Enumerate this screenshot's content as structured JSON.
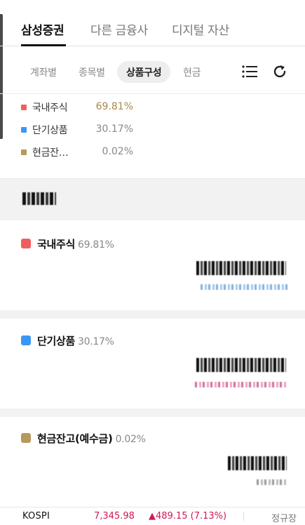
{
  "top_tabs": [
    "삼성증권",
    "다른 금융사",
    "디지털 자산"
  ],
  "sub_tabs": [
    "계좌별",
    "종목별",
    "상품구성",
    "현금"
  ],
  "icons": {
    "list": "list-icon",
    "refresh": "refresh-icon"
  },
  "legend": [
    {
      "label": "국내주식",
      "value": "69.81%",
      "color": "#ef5f5f"
    },
    {
      "label": "단기상품",
      "value": "30.17%",
      "color": "#3a97f3"
    },
    {
      "label": "현금잔…",
      "value": "0.02%",
      "color": "#b59a5c"
    }
  ],
  "cards": [
    {
      "label": "국내주식",
      "percent": "69.81%",
      "color": "#ef5f5f"
    },
    {
      "label": "단기상품",
      "percent": "30.17%",
      "color": "#3a97f3"
    },
    {
      "label": "현금잔고(예수금)",
      "percent": "0.02%",
      "color": "#b59a5c"
    }
  ],
  "ticker": {
    "name": "KOSPI",
    "value": "7,345.98",
    "change": "▲489.15 (7.13%)",
    "state": "정규장"
  }
}
